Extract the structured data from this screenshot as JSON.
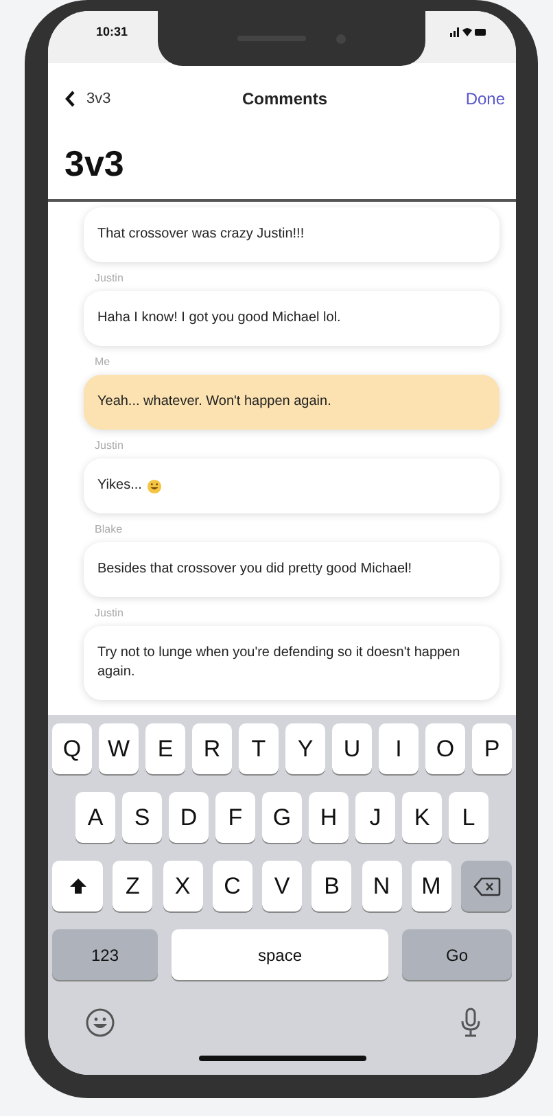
{
  "status_bar": {
    "time": "10:31"
  },
  "nav_bar": {
    "back_label": "3v3",
    "title": "Comments",
    "action": "Done"
  },
  "large_title": "3v3",
  "comments": [
    {
      "text": "That crossover was crazy Justin!!!",
      "mine": false,
      "emoji": false
    },
    {
      "author": "Justin",
      "text": "Haha I know! I got you good Michael lol.",
      "mine": false,
      "emoji": false
    },
    {
      "author": "Me",
      "text": "Yeah... whatever. Won't happen again.",
      "mine": true,
      "emoji": false
    },
    {
      "author": "Justin",
      "text": "Yikes...",
      "mine": false,
      "emoji": true
    },
    {
      "author": "Blake",
      "text": "Besides that crossover you did pretty good Michael!",
      "mine": false,
      "emoji": false
    },
    {
      "author": "Justin",
      "text": "Try not to lunge when you're defending so it doesn't happen again.",
      "mine": false,
      "emoji": false
    }
  ],
  "keyboard": {
    "rows": [
      {
        "keys": [
          {
            "kind": "letter",
            "label": "Q"
          },
          {
            "kind": "letter",
            "label": "W"
          },
          {
            "kind": "letter",
            "label": "E"
          },
          {
            "kind": "letter",
            "label": "R"
          },
          {
            "kind": "letter",
            "label": "T"
          },
          {
            "kind": "letter",
            "label": "Y"
          },
          {
            "kind": "letter",
            "label": "U"
          },
          {
            "kind": "letter",
            "label": "I"
          },
          {
            "kind": "letter",
            "label": "O"
          },
          {
            "kind": "letter",
            "label": "P"
          }
        ]
      },
      {
        "keys": [
          {
            "kind": "letter",
            "label": "A"
          },
          {
            "kind": "letter",
            "label": "S"
          },
          {
            "kind": "letter",
            "label": "D"
          },
          {
            "kind": "letter",
            "label": "F"
          },
          {
            "kind": "letter",
            "label": "G"
          },
          {
            "kind": "letter",
            "label": "H"
          },
          {
            "kind": "letter",
            "label": "J"
          },
          {
            "kind": "letter",
            "label": "K"
          },
          {
            "kind": "letter",
            "label": "L"
          }
        ]
      },
      {
        "keys": [
          {
            "kind": "shift"
          },
          {
            "kind": "letter",
            "label": "Z"
          },
          {
            "kind": "letter",
            "label": "X"
          },
          {
            "kind": "letter",
            "label": "C"
          },
          {
            "kind": "letter",
            "label": "V"
          },
          {
            "kind": "letter",
            "label": "B"
          },
          {
            "kind": "letter",
            "label": "N"
          },
          {
            "kind": "letter",
            "label": "M"
          },
          {
            "kind": "delete"
          }
        ]
      }
    ],
    "bottom_keys": [
      {
        "kind": "numbers",
        "label": "123"
      },
      {
        "kind": "space",
        "label": "space"
      },
      {
        "kind": "return",
        "label": "Go"
      }
    ]
  }
}
